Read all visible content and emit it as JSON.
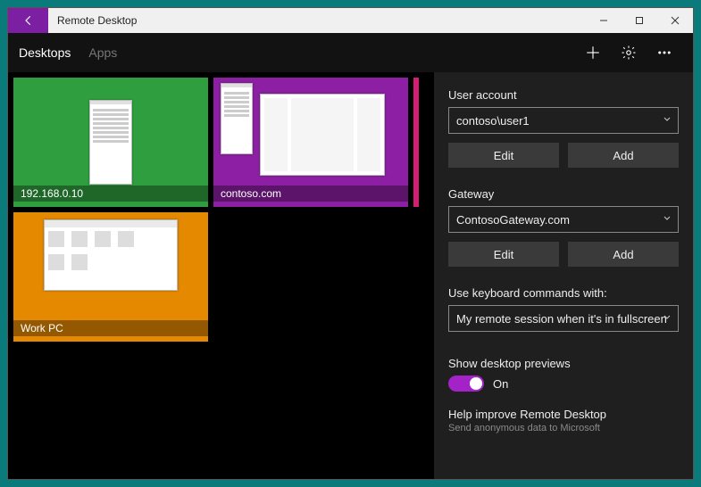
{
  "window": {
    "title": "Remote Desktop"
  },
  "tabs": {
    "desktops": "Desktops",
    "apps": "Apps"
  },
  "tiles": [
    {
      "label": "192.168.0.10"
    },
    {
      "label": "contoso.com"
    },
    {
      "label": "Work PC"
    }
  ],
  "panel": {
    "userAccount": {
      "label": "User account",
      "selected": "contoso\\user1",
      "editLabel": "Edit",
      "addLabel": "Add"
    },
    "gateway": {
      "label": "Gateway",
      "selected": "ContosoGateway.com",
      "editLabel": "Edit",
      "addLabel": "Add"
    },
    "keyboard": {
      "label": "Use keyboard commands with:",
      "selected": "My remote session when it's in fullscreen"
    },
    "previews": {
      "label": "Show desktop previews",
      "state": "On"
    },
    "feedback": {
      "title": "Help improve Remote Desktop",
      "subtitle": "Send anonymous data to Microsoft"
    }
  }
}
